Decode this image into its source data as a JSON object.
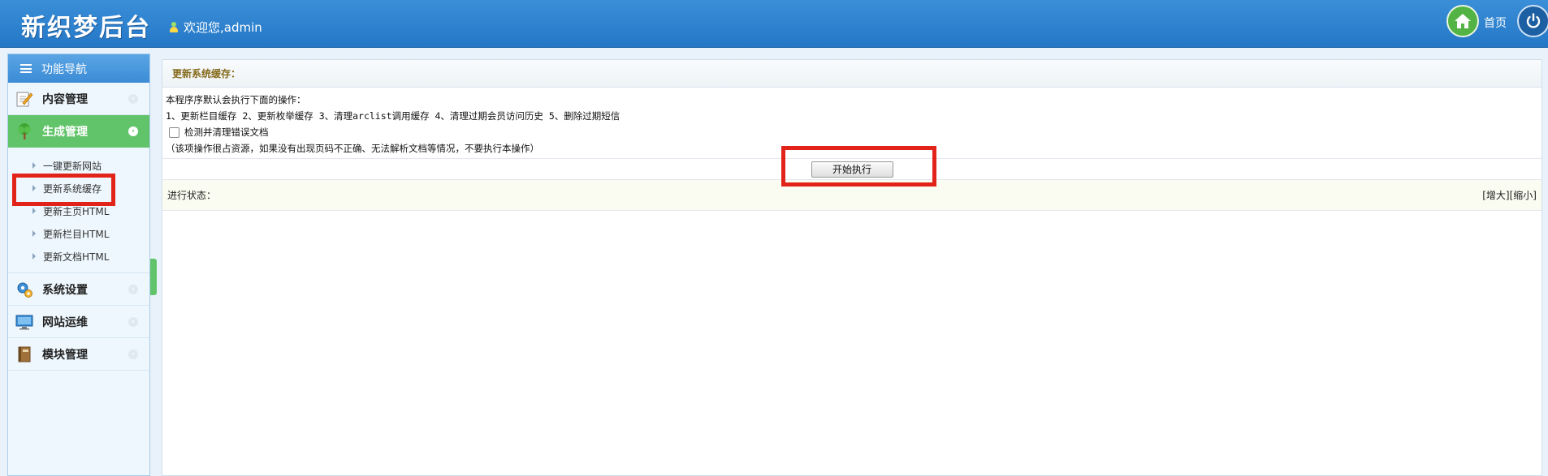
{
  "header": {
    "logo": "新织梦后台",
    "welcome": "欢迎您,admin",
    "home_label": "首页"
  },
  "sidebar": {
    "title": "功能导航",
    "menus": [
      {
        "label": "内容管理",
        "icon": "edit-icon",
        "active": false
      },
      {
        "label": "生成管理",
        "icon": "tree-icon",
        "active": true,
        "items": [
          "一键更新网站",
          "更新系统缓存",
          "更新主页HTML",
          "更新栏目HTML",
          "更新文档HTML"
        ]
      },
      {
        "label": "系统设置",
        "icon": "gear-icon",
        "active": false
      },
      {
        "label": "网站运维",
        "icon": "monitor-icon",
        "active": false
      },
      {
        "label": "模块管理",
        "icon": "book-icon",
        "active": false
      }
    ]
  },
  "main": {
    "title": "更新系统缓存：",
    "desc_line1": "本程序序默认会执行下面的操作：",
    "desc_line2": "1、更新栏目缓存 2、更新枚举缓存 3、清理arclist调用缓存 4、清理过期会员访问历史 5、删除过期短信",
    "checkbox_label": "检测并清理错误文档",
    "note": "（该项操作很占资源，如果没有出现页码不正确、无法解析文档等情况，不要执行本操作）",
    "run_button": "开始执行",
    "status_label": "进行状态：",
    "enlarge": "[增大]",
    "shrink": "[缩小]"
  },
  "colors": {
    "header_blue": "#2d82cf",
    "active_green": "#62c46a",
    "highlight_red": "#e2231a",
    "title_gold": "#866c1d"
  }
}
